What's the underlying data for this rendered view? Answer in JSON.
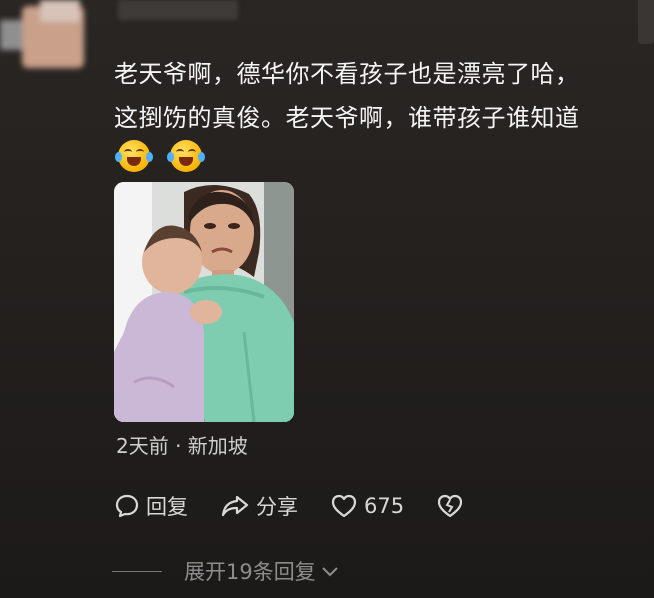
{
  "comment": {
    "text_line1": "老天爷啊，德华你不看孩子也是漂亮了哈，",
    "text_line2": "这捯饬的真俊。老天爷啊，谁带孩子谁知道",
    "emojis": [
      "laugh-cry-emoji",
      "laugh-cry-emoji"
    ],
    "timestamp": "2天前 · 新加坡"
  },
  "actions": {
    "reply_label": "回复",
    "share_label": "分享",
    "like_count": "675"
  },
  "replies": {
    "expand_label": "展开19条回复"
  },
  "colors": {
    "background": "#221f1d",
    "text": "#f5f5f5",
    "muted": "#8d8d8d"
  }
}
